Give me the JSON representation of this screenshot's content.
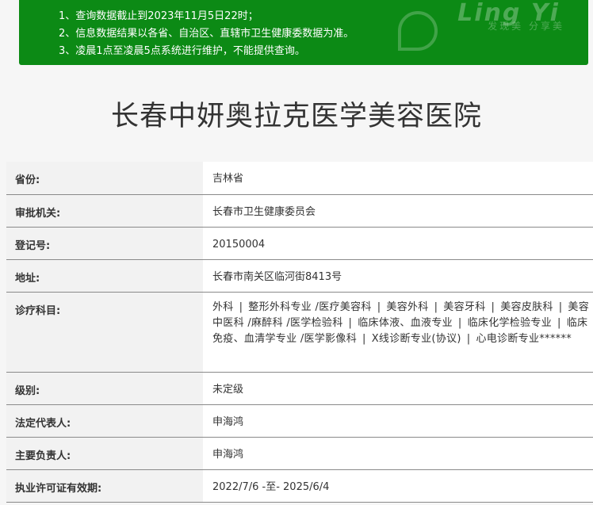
{
  "notice": {
    "lines": [
      "1、查询数据截止到2023年11月5日22时；",
      "2、信息数据结果以各省、自治区、直辖市卫生健康委数据为准。",
      "3、凌晨1点至凌晨5点系统进行维护，不能提供查询。"
    ],
    "watermark_brand": "Ling Yi",
    "watermark_slogan": "发现美 分享美",
    "background_color": "#0c8a15"
  },
  "hospital": {
    "name": "长春中妍奥拉克医学美容医院"
  },
  "details": {
    "province": {
      "label": "省份:",
      "value": "吉林省"
    },
    "approval_authority": {
      "label": "审批机关:",
      "value": "长春市卫生健康委员会"
    },
    "registration_no": {
      "label": "登记号:",
      "value": "20150004"
    },
    "address": {
      "label": "地址:",
      "value": "长春市南关区临河街8413号"
    },
    "departments": {
      "label": "诊疗科目:",
      "items": [
        "外科",
        "整形外科专业 /医疗美容科",
        "美容外科",
        "美容牙科",
        "美容皮肤科",
        "美容中医科 /麻醉科 /医学检验科",
        "临床体液、血液专业",
        "临床化学检验专业",
        "临床免疫、血清学专业 /医学影像科",
        "X线诊断专业(协议)",
        "心电诊断专业******"
      ],
      "separator": "|"
    },
    "level": {
      "label": "级别:",
      "value": "未定级"
    },
    "legal_representative": {
      "label": "法定代表人:",
      "value": "申海鸿"
    },
    "principal": {
      "label": "主要负责人:",
      "value": "申海鸿"
    },
    "license_validity": {
      "label": "执业许可证有效期:",
      "value": "2022/7/6 -至- 2025/6/4"
    }
  }
}
